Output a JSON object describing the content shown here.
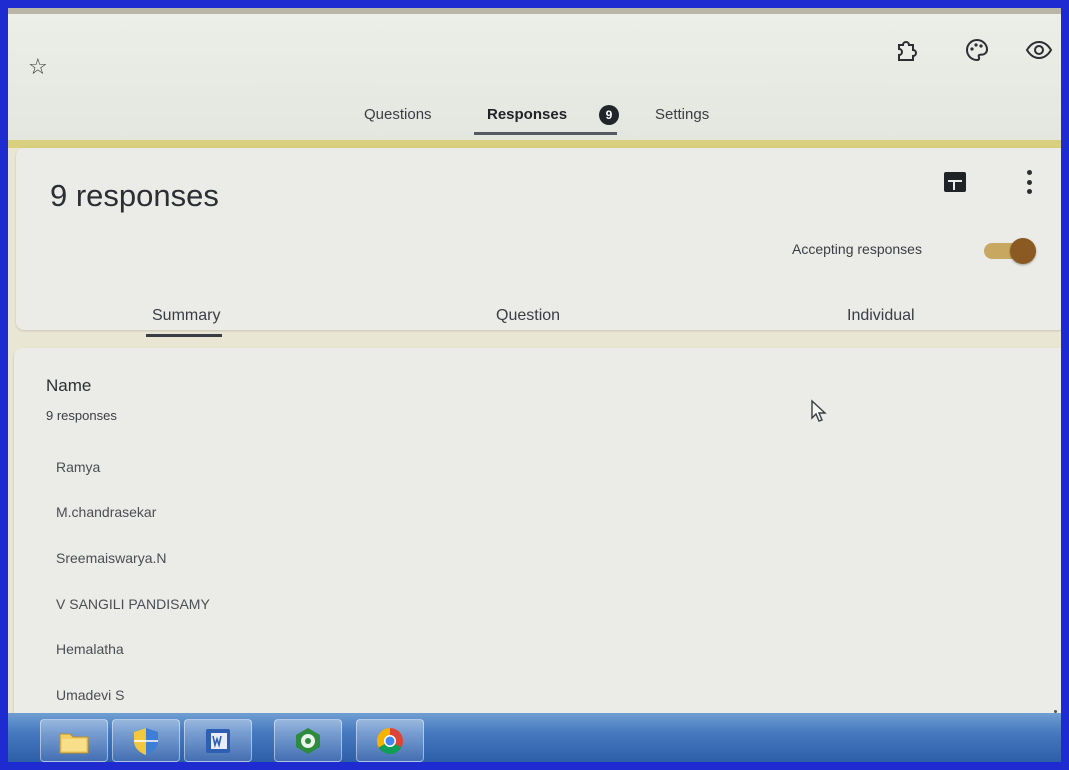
{
  "top_icons": [
    "star-icon",
    "puzzle-icon",
    "palette-icon",
    "eye-icon"
  ],
  "tabs": [
    {
      "label": "Questions"
    },
    {
      "label": "Responses"
    },
    {
      "label": "Settings"
    }
  ],
  "responses_badge": "9",
  "summary_card": {
    "title": "9 responses",
    "accepting_label": "Accepting responses",
    "accepting_on": true,
    "subtabs": [
      {
        "label": "Summary"
      },
      {
        "label": "Question"
      },
      {
        "label": "Individual"
      }
    ]
  },
  "name_card": {
    "heading": "Name",
    "count": "9 responses",
    "names": [
      "Ramya",
      "M.chandrasekar",
      "Sreemaiswarya.N",
      "V SANGILI PANDISAMY",
      "Hemalatha",
      "Umadevi S"
    ]
  },
  "taskbar": {
    "apps": [
      "folder-icon",
      "shield-icon",
      "word-icon",
      "ico-icon",
      "chrome-icon"
    ]
  },
  "colors": {
    "accent": "#d8d07e",
    "toggle": "#8a5a22",
    "taskbar": "#4679bf"
  }
}
